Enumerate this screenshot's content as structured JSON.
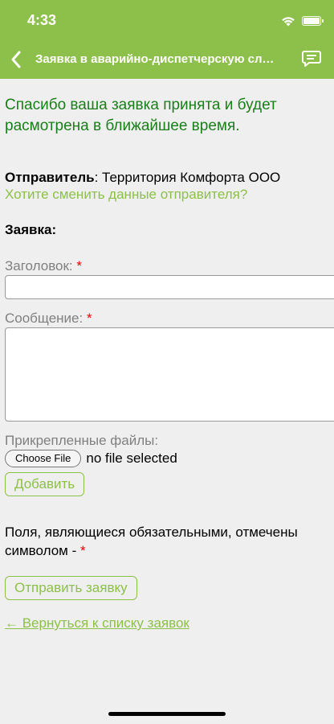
{
  "status_bar": {
    "time": "4:33"
  },
  "nav": {
    "title": "Заявка в аварийно-диспетчерскую службу"
  },
  "success_message": "Спасибо ваша заявка принята и будет расмотрена в ближайшее время.",
  "sender": {
    "label": "Отправитель",
    "separator": ": ",
    "value": "Территория Комфорта ООО",
    "change_link": "Хотите сменить данные отправителя?"
  },
  "form": {
    "section_title": "Заявка:",
    "title_label": "Заголовок:",
    "message_label": "Сообщение:",
    "required_mark": "*",
    "title_value": "",
    "message_value": "",
    "attachments_label": "Прикрепленные файлы:",
    "choose_file": "Choose File",
    "no_file": "no file selected",
    "add_button": "Добавить",
    "required_note": "Поля, являющиеся обязательными, отмечены символом - ",
    "submit_button": "Отправить заявку",
    "back_link": "← Вернуться к списку заявок"
  },
  "colors": {
    "accent": "#8dc04a",
    "success": "#1a7f1a",
    "required": "#ee0000",
    "background": "#efefef"
  },
  "icons": [
    "wifi-icon",
    "battery-icon",
    "chevron-left-icon",
    "chat-icon"
  ]
}
